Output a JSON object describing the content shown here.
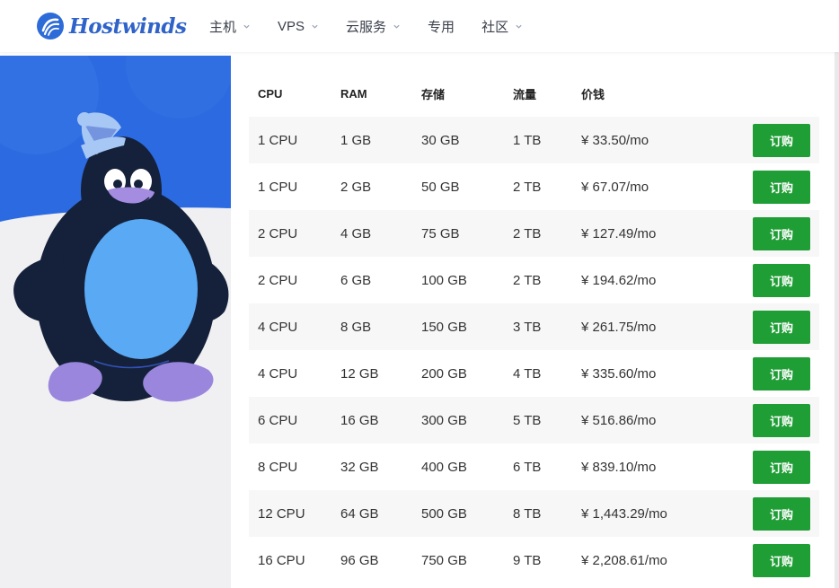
{
  "brand": {
    "name": "Hostwinds",
    "color": "#2f63c9"
  },
  "nav": [
    {
      "label": "主机",
      "has_dropdown": true
    },
    {
      "label": "VPS",
      "has_dropdown": true
    },
    {
      "label": "云服务",
      "has_dropdown": true
    },
    {
      "label": "专用",
      "has_dropdown": false
    },
    {
      "label": "社区",
      "has_dropdown": true
    }
  ],
  "table": {
    "headers": [
      "CPU",
      "RAM",
      "存储",
      "流量",
      "价钱"
    ],
    "rows": [
      {
        "cpu": "1 CPU",
        "ram": "1 GB",
        "storage": "30 GB",
        "traffic": "1 TB",
        "price": "¥ 33.50/mo",
        "button": "订购"
      },
      {
        "cpu": "1 CPU",
        "ram": "2 GB",
        "storage": "50 GB",
        "traffic": "2 TB",
        "price": "¥ 67.07/mo",
        "button": "订购"
      },
      {
        "cpu": "2 CPU",
        "ram": "4 GB",
        "storage": "75 GB",
        "traffic": "2 TB",
        "price": "¥ 127.49/mo",
        "button": "订购"
      },
      {
        "cpu": "2 CPU",
        "ram": "6 GB",
        "storage": "100 GB",
        "traffic": "2 TB",
        "price": "¥ 194.62/mo",
        "button": "订购"
      },
      {
        "cpu": "4 CPU",
        "ram": "8 GB",
        "storage": "150 GB",
        "traffic": "3 TB",
        "price": "¥ 261.75/mo",
        "button": "订购"
      },
      {
        "cpu": "4 CPU",
        "ram": "12 GB",
        "storage": "200 GB",
        "traffic": "4 TB",
        "price": "¥ 335.60/mo",
        "button": "订购"
      },
      {
        "cpu": "6 CPU",
        "ram": "16 GB",
        "storage": "300 GB",
        "traffic": "5 TB",
        "price": "¥ 516.86/mo",
        "button": "订购"
      },
      {
        "cpu": "8 CPU",
        "ram": "32 GB",
        "storage": "400 GB",
        "traffic": "6 TB",
        "price": "¥ 839.10/mo",
        "button": "订购"
      },
      {
        "cpu": "12 CPU",
        "ram": "64 GB",
        "storage": "500 GB",
        "traffic": "8 TB",
        "price": "¥ 1,443.29/mo",
        "button": "订购"
      },
      {
        "cpu": "16 CPU",
        "ram": "96 GB",
        "storage": "750 GB",
        "traffic": "9 TB",
        "price": "¥ 2,208.61/mo",
        "button": "订购"
      }
    ]
  },
  "colors": {
    "buy_button": "#1f9e35",
    "hero_blue": "#2b6ae0",
    "row_shade": "#f7f7f8"
  },
  "hero_icon": "linux-tux-penguin-illustration"
}
